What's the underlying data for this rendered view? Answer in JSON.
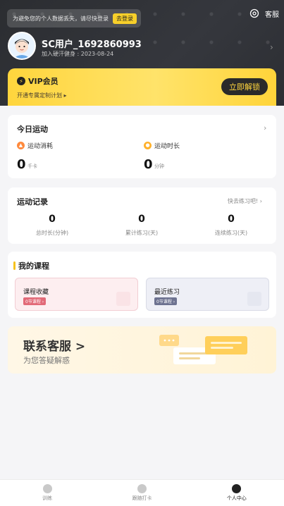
{
  "header": {
    "notice_text": "为避免您的个人数据丢失，请尽快登录",
    "notice_button": "去登录",
    "service_label": "客服",
    "settings_icon": "settings-icon"
  },
  "profile": {
    "username": "SC用户_1692860993",
    "joined": "加入硬汗健身 : 2023-08-24",
    "avatar_icon": "avatar-icon"
  },
  "vip": {
    "title": "VIP会员",
    "subtitle": "开通专属定制计划",
    "button": "立即解锁",
    "accent": "#ffd53d"
  },
  "today": {
    "title": "今日运动",
    "calories_label": "运动消耗",
    "calories_value": "0",
    "calories_unit": "千卡",
    "duration_label": "运动时长",
    "duration_value": "0",
    "duration_unit": "分钟"
  },
  "records": {
    "title": "运动记录",
    "hint": "快去练习吧!",
    "items": [
      {
        "value": "0",
        "label": "总时长(分钟)"
      },
      {
        "value": "0",
        "label": "累计练习(天)"
      },
      {
        "value": "0",
        "label": "连续练习(天)"
      }
    ]
  },
  "courses": {
    "title": "我的课程",
    "favorite_label": "课程收藏",
    "favorite_tag": "0节课程",
    "recent_label": "最近练习",
    "recent_tag": "0节课程"
  },
  "service": {
    "title": "联系客服 >",
    "subtitle": "为您答疑解惑"
  },
  "tabs": [
    {
      "label": "训练",
      "icon": "training-icon"
    },
    {
      "label": "跟随打卡",
      "icon": "checkin-icon"
    },
    {
      "label": "个人中心",
      "icon": "profile-icon"
    }
  ]
}
